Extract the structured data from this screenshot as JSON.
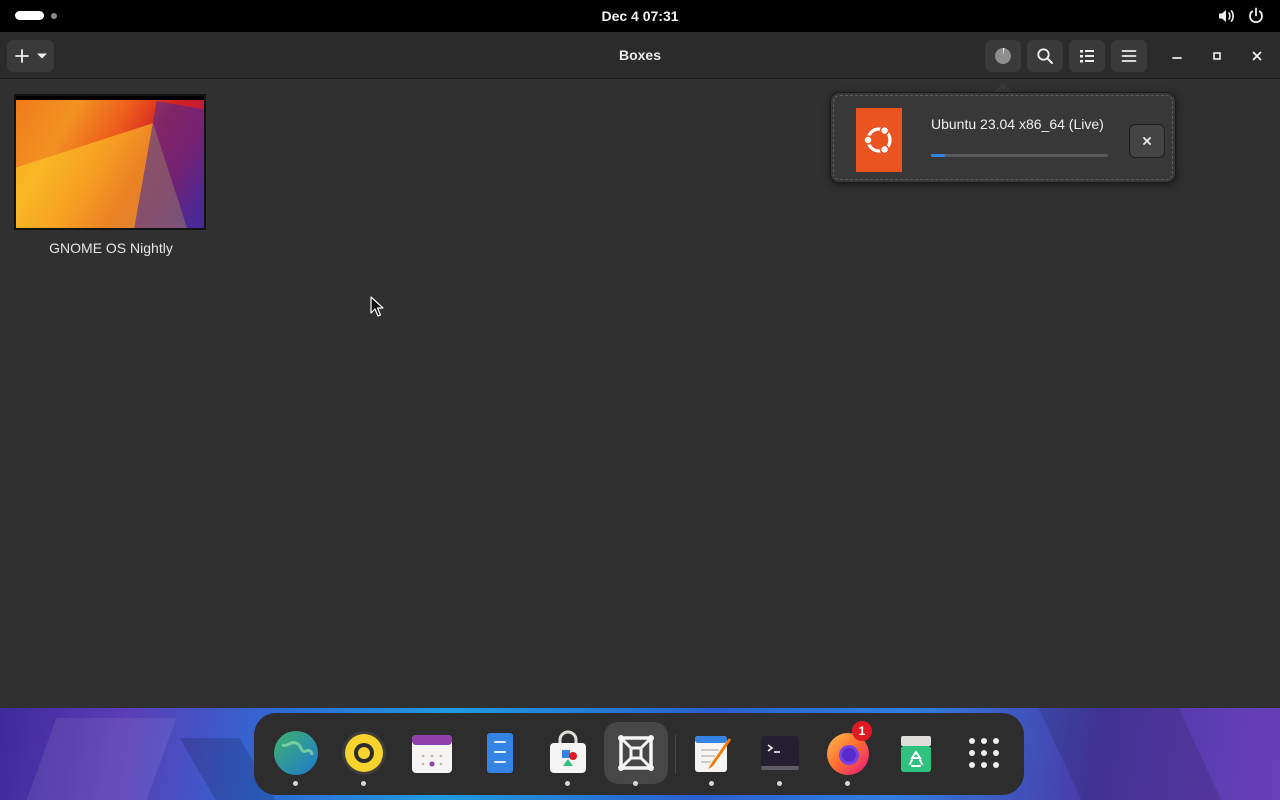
{
  "top_bar": {
    "clock": "Dec 4  07:31",
    "tray_icons": [
      "volume-icon",
      "power-icon"
    ]
  },
  "window": {
    "title": "Boxes",
    "header_buttons": [
      "add-icon",
      "dropdown-arrow-icon",
      "downloads-progress-icon",
      "search-icon",
      "list-view-icon",
      "hamburger-menu-icon"
    ],
    "window_controls": [
      "minimize-icon",
      "maximize-icon",
      "close-icon"
    ]
  },
  "machines": [
    {
      "name": "GNOME OS Nightly"
    }
  ],
  "downloads": {
    "items": [
      {
        "title": "Ubuntu 23.04 x86_64 (Live)",
        "progress": 0.08
      }
    ]
  },
  "dock": {
    "items": [
      {
        "name": "web-browser",
        "running": true
      },
      {
        "name": "rhythmbox",
        "running": true
      },
      {
        "name": "calendar",
        "running": false
      },
      {
        "name": "files",
        "running": false
      },
      {
        "name": "software",
        "running": true
      },
      {
        "name": "boxes",
        "running": true,
        "active": true
      },
      {
        "name": "text-editor",
        "running": true
      },
      {
        "name": "terminal",
        "running": true
      },
      {
        "name": "firefox",
        "running": true,
        "badge": "1"
      },
      {
        "name": "recycle-bin",
        "running": false
      },
      {
        "name": "app-grid",
        "running": false
      }
    ]
  },
  "colors": {
    "accent": "#3584e4",
    "ubuntu_orange": "#e95420",
    "badge_red": "#e01b24"
  }
}
